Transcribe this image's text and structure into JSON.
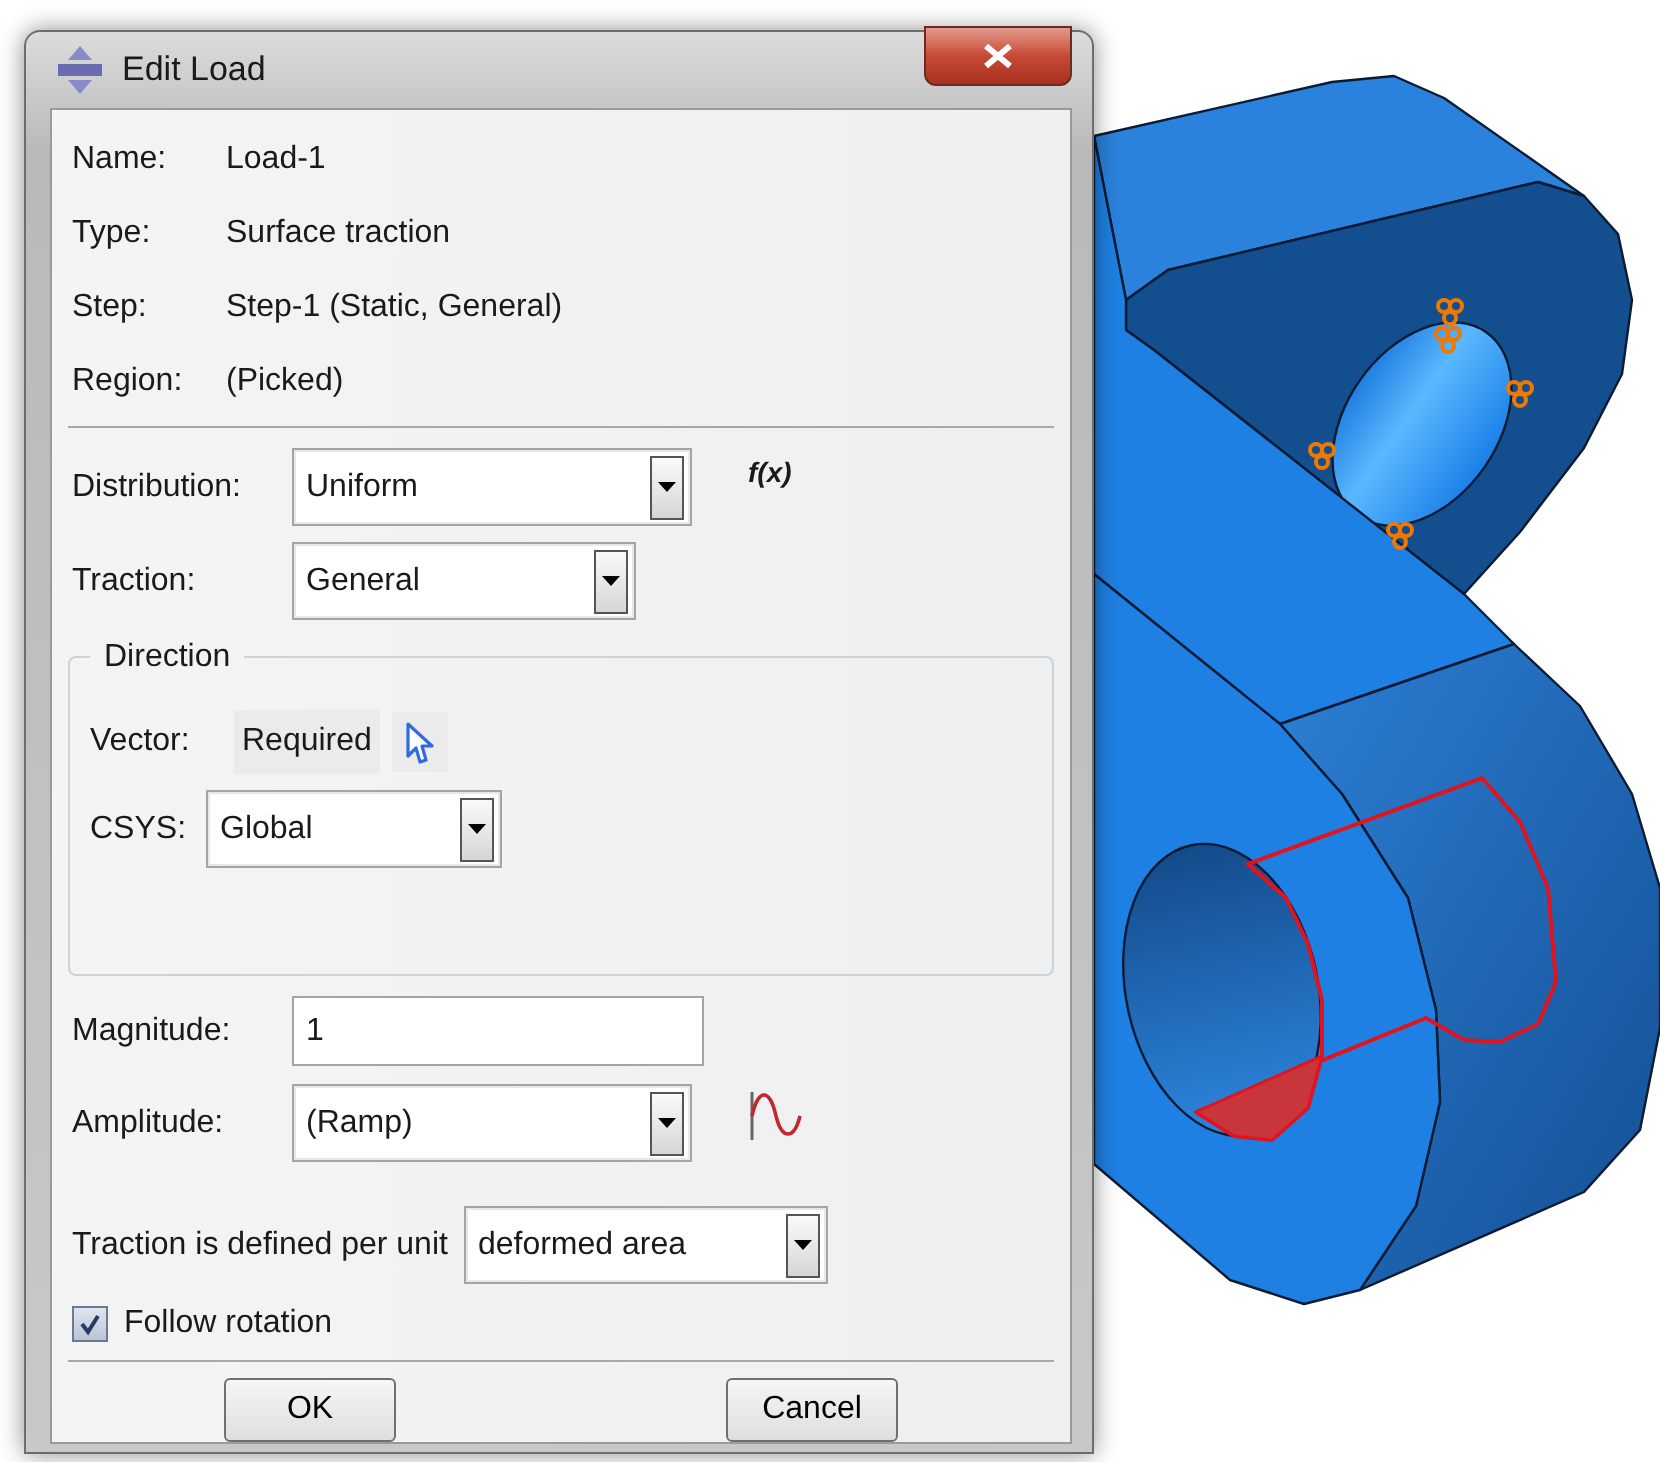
{
  "window": {
    "title": "Edit Load"
  },
  "info": [
    {
      "label": "Name:",
      "value": "Load-1"
    },
    {
      "label": "Type:",
      "value": "Surface traction"
    },
    {
      "label": "Step:",
      "value": "Step-1 (Static, General)"
    },
    {
      "label": "Region:",
      "value": "(Picked)"
    }
  ],
  "distribution": {
    "label": "Distribution:",
    "value": "Uniform",
    "function_label": "f(x)"
  },
  "traction": {
    "label": "Traction:",
    "value": "General"
  },
  "direction": {
    "title": "Direction",
    "vector_label": "Vector:",
    "vector_value": "Required",
    "csys_label": "CSYS:",
    "csys_value": "Global"
  },
  "magnitude": {
    "label": "Magnitude:",
    "value": "1"
  },
  "amplitude": {
    "label": "Amplitude:",
    "value": "(Ramp)"
  },
  "traction_basis": {
    "label": "Traction is defined per unit",
    "value": "deformed area"
  },
  "follow_rotation": {
    "label": "Follow rotation",
    "checked": true
  },
  "buttons": [
    "OK",
    "Cancel"
  ]
}
